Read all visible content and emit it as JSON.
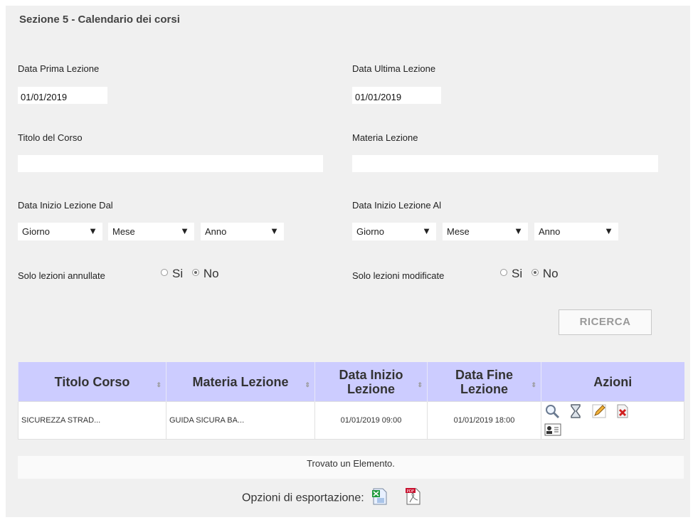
{
  "section": {
    "title": "Sezione 5 - Calendario dei corsi"
  },
  "form": {
    "data_prima_lezione": {
      "label": "Data Prima Lezione",
      "value": "01/01/2019"
    },
    "data_ultima_lezione": {
      "label": "Data Ultima Lezione",
      "value": "01/01/2019"
    },
    "titolo_corso": {
      "label": "Titolo del Corso",
      "value": ""
    },
    "materia_lezione": {
      "label": "Materia Lezione",
      "value": ""
    },
    "inizio_dal": {
      "label": "Data Inizio Lezione Dal",
      "giorno": "Giorno",
      "mese": "Mese",
      "anno": "Anno"
    },
    "inizio_al": {
      "label": "Data Inizio Lezione Al",
      "giorno": "Giorno",
      "mese": "Mese",
      "anno": "Anno"
    },
    "annullate": {
      "label": "Solo lezioni annullate",
      "si": "Si",
      "no": "No",
      "selected": "No"
    },
    "modificate": {
      "label": "Solo lezioni modificate",
      "si": "Si",
      "no": "No",
      "selected": "No"
    },
    "search_button": "RICERCA",
    "dropdown_arrow": "▼"
  },
  "table": {
    "headers": {
      "titolo": "Titolo Corso",
      "materia": "Materia Lezione",
      "inizio": "Data Inizio Lezione",
      "fine": "Data Fine Lezione",
      "azioni": "Azioni"
    },
    "rows": [
      {
        "titolo": "SICUREZZA STRAD...",
        "materia": "GUIDA SICURA BA...",
        "inizio": "01/01/2019 09:00",
        "fine": "01/01/2019 18:00",
        "actions": [
          "search-icon",
          "hourglass-icon",
          "edit-icon",
          "delete-icon",
          "user-card-icon"
        ]
      }
    ],
    "status": "Trovato un Elemento.",
    "sort_glyph": "⇕"
  },
  "export": {
    "label": "Opzioni di esportazione:",
    "icons": [
      "excel-export-icon",
      "pdf-export-icon"
    ]
  },
  "colors": {
    "panel_bg": "#f0f0f0",
    "header_bg": "#ccccff",
    "button_text": "#999999"
  }
}
